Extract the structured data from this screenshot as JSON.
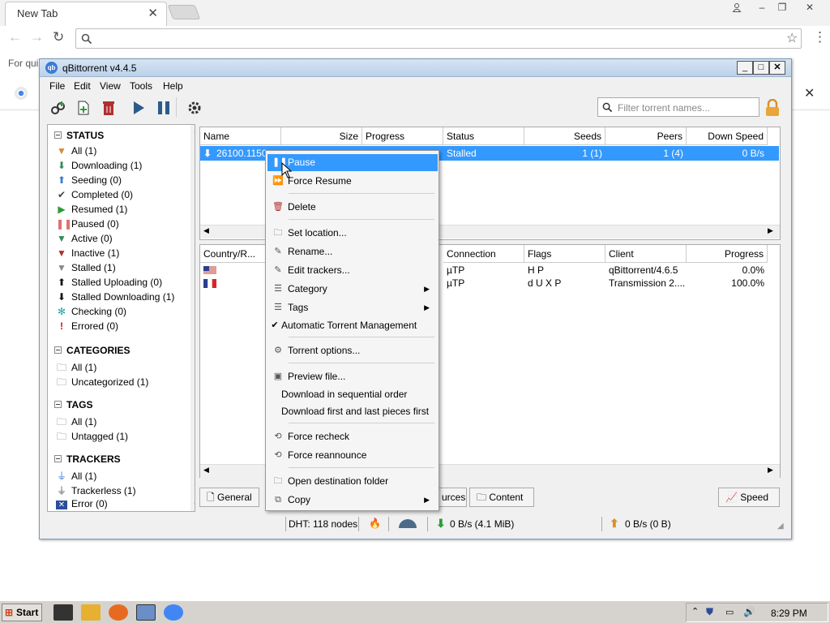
{
  "browser": {
    "tab_title": "New Tab",
    "bookmark_hint": "For qui",
    "close_glyph": "✕",
    "menu_glyph": "⋮"
  },
  "app": {
    "title": "qBittorrent v4.4.5",
    "menus": [
      "File",
      "Edit",
      "View",
      "Tools",
      "Help"
    ],
    "filter_placeholder": "Filter torrent names..."
  },
  "sidebar": {
    "status_heading": "STATUS",
    "status_items": [
      {
        "label": "All (1)",
        "icon": "filter-icon",
        "color": "#d08a30"
      },
      {
        "label": "Downloading (1)",
        "icon": "arrow-down-icon",
        "color": "#2e8b57"
      },
      {
        "label": "Seeding (0)",
        "icon": "arrow-up-icon",
        "color": "#3a7bd5"
      },
      {
        "label": "Completed (0)",
        "icon": "check-icon",
        "color": "#444"
      },
      {
        "label": "Resumed (1)",
        "icon": "play-icon",
        "color": "#2e9b3a"
      },
      {
        "label": "Paused (0)",
        "icon": "pause-icon",
        "color": "#e07070"
      },
      {
        "label": "Active (0)",
        "icon": "filter-icon",
        "color": "#2e8b57"
      },
      {
        "label": "Inactive (1)",
        "icon": "filter-icon",
        "color": "#b03030"
      },
      {
        "label": "Stalled (1)",
        "icon": "filter-icon",
        "color": "#888"
      },
      {
        "label": "Stalled Uploading (0)",
        "icon": "arrow-up-icon",
        "color": "#111"
      },
      {
        "label": "Stalled Downloading (1)",
        "icon": "arrow-down-icon",
        "color": "#111"
      },
      {
        "label": "Checking (0)",
        "icon": "gear-icon",
        "color": "#1aa3a3"
      },
      {
        "label": "Errored (0)",
        "icon": "exclamation-icon",
        "color": "#d01010"
      }
    ],
    "categories_heading": "CATEGORIES",
    "categories": [
      "All (1)",
      "Uncategorized (1)"
    ],
    "tags_heading": "TAGS",
    "tags": [
      "All (1)",
      "Untagged (1)"
    ],
    "trackers_heading": "TRACKERS",
    "trackers": [
      "All (1)",
      "Trackerless (1)",
      "Error (0)"
    ]
  },
  "torrent_list": {
    "columns": [
      "Name",
      "Size",
      "Progress",
      "Status",
      "Seeds",
      "Peers",
      "Down Speed"
    ],
    "rows": [
      {
        "name": "26100.1150",
        "status": "Stalled",
        "seeds": "1 (1)",
        "peers": "1 (4)",
        "down_speed": "0 B/s"
      }
    ]
  },
  "peers": {
    "columns": [
      "Country/R...",
      "Connection",
      "Flags",
      "Client",
      "Progress"
    ],
    "rows": [
      {
        "connection": "µTP",
        "flags": "H P",
        "client": "qBittorrent/4.6.5",
        "progress": "0.0%"
      },
      {
        "connection": "µTP",
        "flags": "d U X P",
        "client": "Transmission 2....",
        "progress": "100.0%"
      }
    ]
  },
  "detail_tabs": [
    "General",
    "urces",
    "Content",
    "Speed"
  ],
  "statusbar": {
    "dht": "DHT: 118 nodes",
    "down": "0 B/s (4.1 MiB)",
    "up": "0 B/s (0 B)"
  },
  "context_menu": {
    "items": [
      {
        "label": "Pause",
        "icon": "pause-icon",
        "selected": true
      },
      {
        "label": "Force Resume",
        "icon": "fast-forward-icon"
      },
      {
        "label": "Delete",
        "icon": "trash-icon"
      },
      {
        "label": "Set location...",
        "icon": "folder-icon"
      },
      {
        "label": "Rename...",
        "icon": "rename-icon"
      },
      {
        "label": "Edit trackers...",
        "icon": "edit-icon"
      },
      {
        "label": "Category",
        "icon": "list-icon",
        "submenu": true
      },
      {
        "label": "Tags",
        "icon": "tag-icon",
        "submenu": true
      },
      {
        "label": "Automatic Torrent Management",
        "icon": "check-icon"
      },
      {
        "label": "Torrent options...",
        "icon": "gear-icon"
      },
      {
        "label": "Preview file...",
        "icon": "image-icon"
      },
      {
        "label": "Download in sequential order"
      },
      {
        "label": "Download first and last pieces first"
      },
      {
        "label": "Force recheck",
        "icon": "recheck-icon"
      },
      {
        "label": "Force reannounce",
        "icon": "reannounce-icon"
      },
      {
        "label": "Open destination folder",
        "icon": "folder-icon"
      },
      {
        "label": "Copy",
        "icon": "copy-icon",
        "submenu": true
      }
    ]
  },
  "taskbar": {
    "start_label": "Start",
    "clock": "8:29 PM"
  }
}
